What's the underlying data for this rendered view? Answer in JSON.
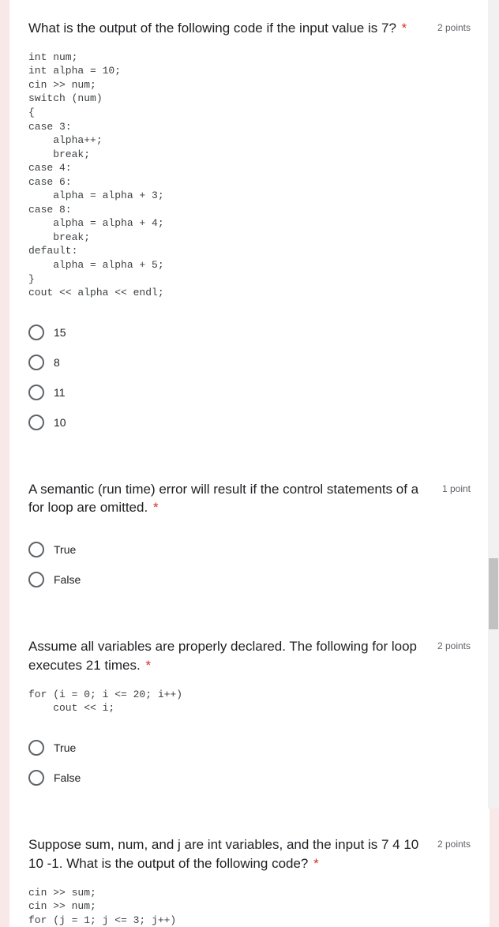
{
  "questions": [
    {
      "title": "What is the output of the following code if the input value is 7?",
      "points": "2 points",
      "code": "int num;\nint alpha = 10;\ncin >> num;\nswitch (num)\n{\ncase 3:\n    alpha++;\n    break;\ncase 4:\ncase 6:\n    alpha = alpha + 3;\ncase 8:\n    alpha = alpha + 4;\n    break;\ndefault:\n    alpha = alpha + 5;\n}\ncout << alpha << endl;",
      "options": [
        "15",
        "8",
        "11",
        "10"
      ]
    },
    {
      "title": "A semantic (run time) error will result if the control statements of a for loop are omitted.",
      "points": "1 point",
      "code": "",
      "options": [
        "True",
        "False"
      ]
    },
    {
      "title": "Assume all variables are properly declared. The following for loop executes 21 times.",
      "points": "2 points",
      "code": "for (i = 0; i <= 20; i++)\n    cout << i;",
      "options": [
        "True",
        "False"
      ]
    },
    {
      "title": "Suppose sum, num, and j are int variables, and the input is 7 4 10 10 -1. What is the output of the following code?",
      "points": "2 points",
      "code": "cin >> sum;\ncin >> num;\nfor (j = 1; j <= 3; j++)",
      "options": []
    }
  ],
  "required_mark": "*"
}
